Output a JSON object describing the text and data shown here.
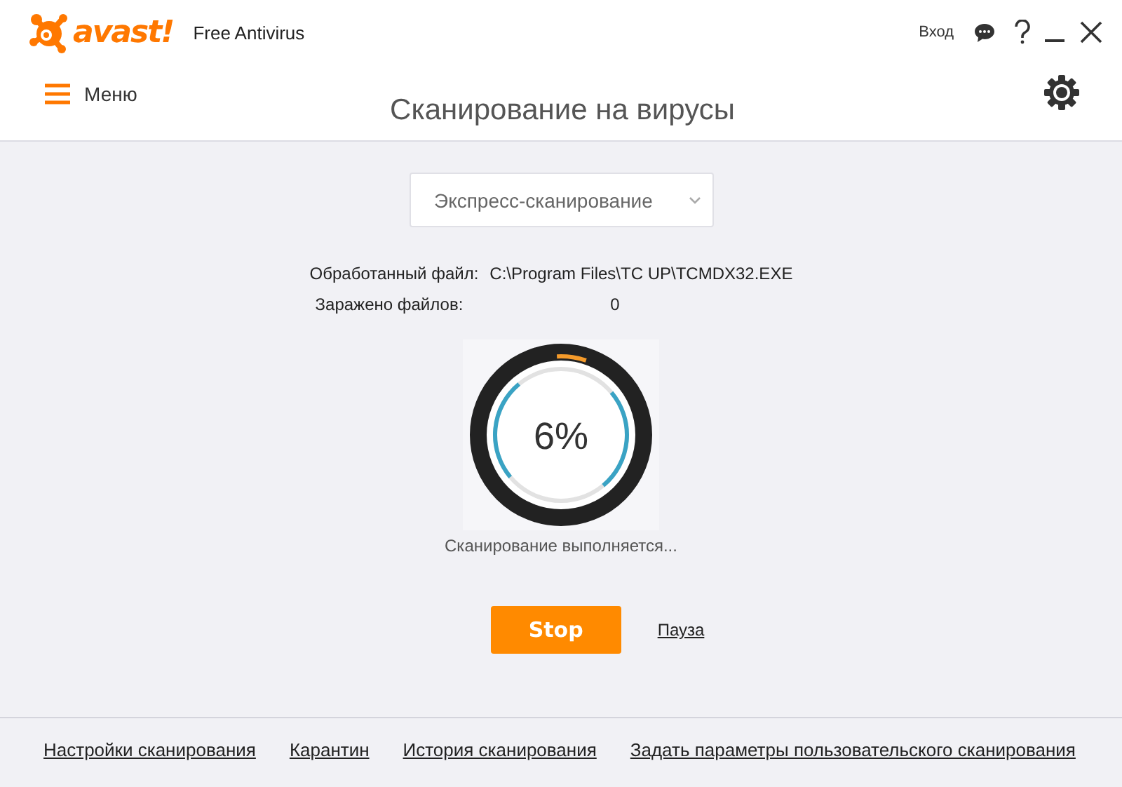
{
  "window": {
    "logo": "avast!",
    "product": "Free Antivirus",
    "login": "Вход"
  },
  "header": {
    "menu_label": "Меню",
    "title": "Сканирование на вирусы"
  },
  "scan": {
    "type_dropdown": {
      "value": "Экспресс-сканирование"
    },
    "info": [
      {
        "label": "Обработанный файл:",
        "value": "C:\\Program Files\\TC UP\\TCMDX32.EXE"
      },
      {
        "label": "Заражено файлов:",
        "value": "0"
      }
    ],
    "progress": {
      "level": 0.06,
      "reading": "6%"
    },
    "status": "Сканирование выполняется...",
    "buttons": [
      {
        "kind": "primary",
        "label": "Stop"
      },
      {
        "kind": "link",
        "label": "Пауза"
      }
    ]
  },
  "footer_links": [
    "Настройки сканирования",
    "Карантин",
    "История сканирования",
    "Задать параметры пользовательского сканирования"
  ]
}
